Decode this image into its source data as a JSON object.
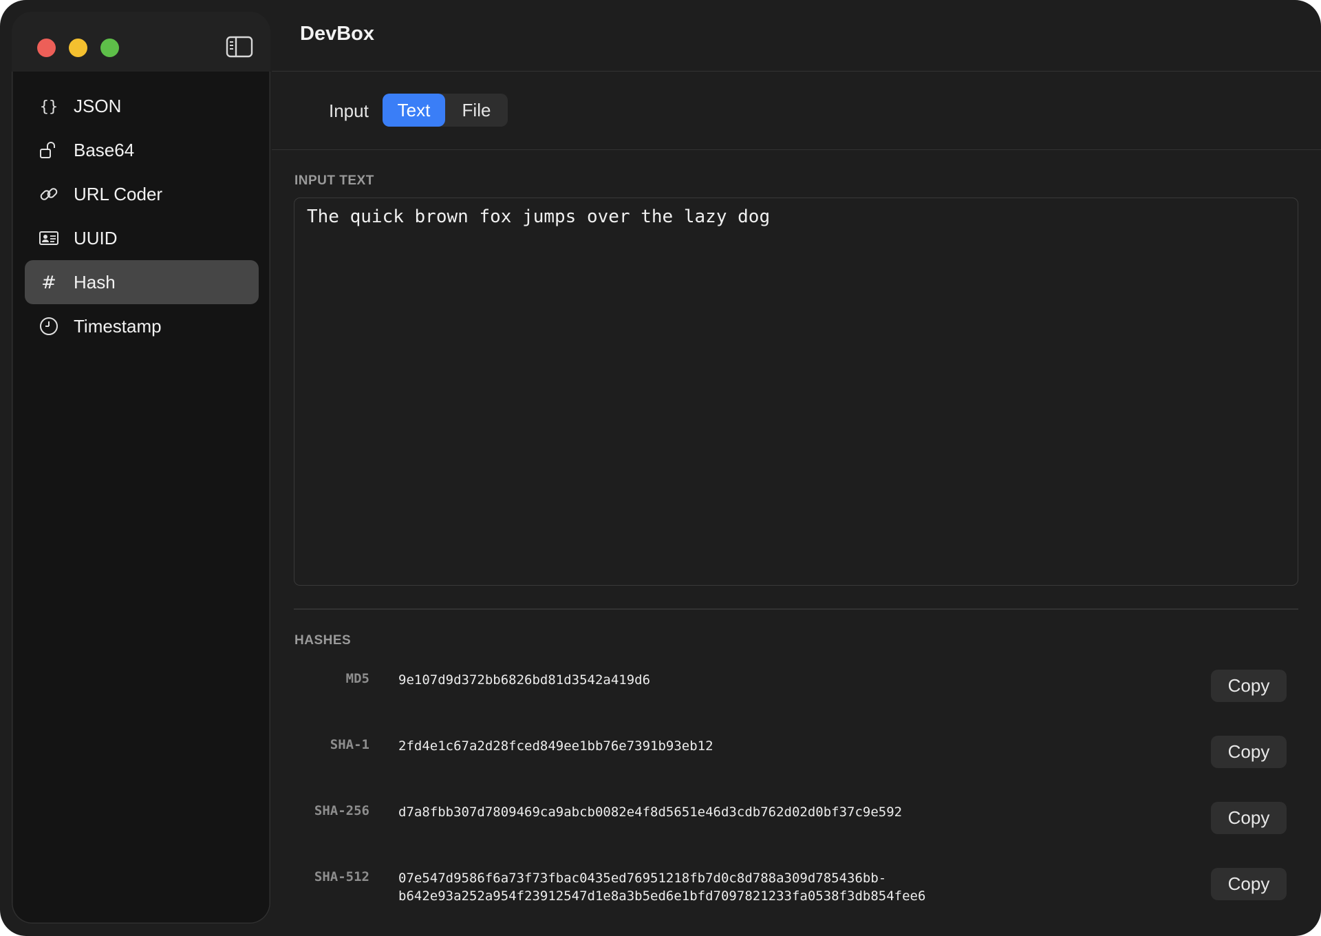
{
  "app": {
    "title": "DevBox"
  },
  "sidebar": {
    "items": [
      {
        "label": "JSON",
        "icon": "braces-icon"
      },
      {
        "label": "Base64",
        "icon": "unlock-icon"
      },
      {
        "label": "URL Coder",
        "icon": "link-icon"
      },
      {
        "label": "UUID",
        "icon": "id-card-icon"
      },
      {
        "label": "Hash",
        "icon": "hashtag-icon",
        "selected": true
      },
      {
        "label": "Timestamp",
        "icon": "clock-icon"
      }
    ]
  },
  "input_mode": {
    "caption": "Input",
    "options": [
      "Text",
      "File"
    ],
    "selected": "Text"
  },
  "input": {
    "label": "INPUT TEXT",
    "value": "The quick brown fox jumps over the lazy dog"
  },
  "hashes": {
    "label": "HASHES",
    "copy_label": "Copy",
    "rows": [
      {
        "name": "MD5",
        "value": "9e107d9d372bb6826bd81d3542a419d6"
      },
      {
        "name": "SHA-1",
        "value": "2fd4e1c67a2d28fced849ee1bb76e7391b93eb12"
      },
      {
        "name": "SHA-256",
        "value": "d7a8fbb307d7809469ca9abcb0082e4f8d5651e46d3cdb762d02d0bf37c9e592"
      },
      {
        "name": "SHA-512",
        "value": "07e547d9586f6a73f73fbac0435ed76951218fb7d0c8d788a309d785436bb-\nb642e93a252a954f23912547d1e8a3b5ed6e1bfd7097821233fa0538f3db854fee6"
      }
    ]
  },
  "colors": {
    "accent": "#3a7ef7",
    "window_bg": "#1e1e1e",
    "sidebar_bg": "#141414",
    "selected_item_bg": "#464646",
    "close": "#ed5f58",
    "minimize": "#f4c02f",
    "maximize": "#5ebf49"
  }
}
